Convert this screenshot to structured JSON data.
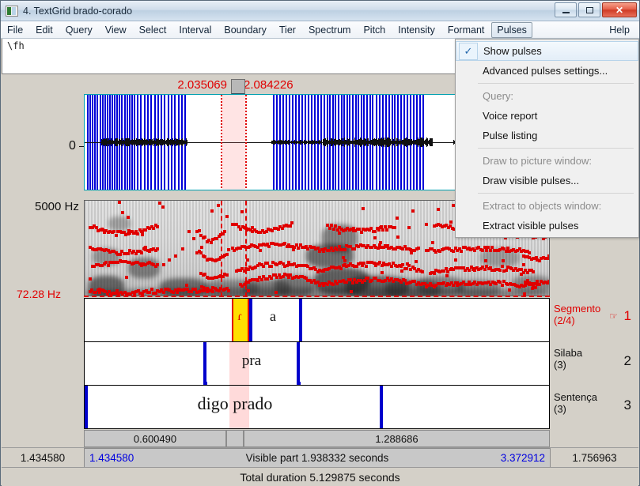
{
  "window": {
    "title": "4. TextGrid brado-corado",
    "icon": "textgrid-icon",
    "minimize_label": "–",
    "restore_label": "□",
    "close_label": "✕"
  },
  "menubar": {
    "items": [
      {
        "label": "File",
        "name": "menu-file"
      },
      {
        "label": "Edit",
        "name": "menu-edit"
      },
      {
        "label": "Query",
        "name": "menu-query"
      },
      {
        "label": "View",
        "name": "menu-view"
      },
      {
        "label": "Select",
        "name": "menu-select"
      },
      {
        "label": "Interval",
        "name": "menu-interval"
      },
      {
        "label": "Boundary",
        "name": "menu-boundary"
      },
      {
        "label": "Tier",
        "name": "menu-tier"
      },
      {
        "label": "Spectrum",
        "name": "menu-spectrum"
      },
      {
        "label": "Pitch",
        "name": "menu-pitch"
      },
      {
        "label": "Intensity",
        "name": "menu-intensity"
      },
      {
        "label": "Formant",
        "name": "menu-formant"
      },
      {
        "label": "Pulses",
        "name": "menu-pulses"
      }
    ],
    "help_label": "Help"
  },
  "pulses_menu": {
    "open": true,
    "checkmark": "✓",
    "items": [
      {
        "label": "Show pulses",
        "type": "check",
        "checked": true
      },
      {
        "label": "Advanced pulses settings...",
        "type": "item"
      },
      {
        "label": "Query:",
        "type": "header"
      },
      {
        "label": "Voice report",
        "type": "item"
      },
      {
        "label": "Pulse listing",
        "type": "item"
      },
      {
        "label": "Draw to picture window:",
        "type": "header"
      },
      {
        "label": "Draw visible pulses...",
        "type": "item"
      },
      {
        "label": "Extract to objects window:",
        "type": "header"
      },
      {
        "label": "Extract visible pulses",
        "type": "item"
      }
    ]
  },
  "textfield": {
    "value": "\\fh"
  },
  "cursor": {
    "start_time": "2.035069",
    "end_time": "2.084226"
  },
  "waveform": {
    "zero_label": "0"
  },
  "spectrogram": {
    "max_freq_label": "5000 Hz",
    "min_freq_label": "72.28 Hz"
  },
  "tiers": [
    {
      "number": "1",
      "name": "Segmento",
      "count": "(2/4)",
      "selected": true,
      "pointer_icon": "pointing-hand-icon",
      "intervals": [
        {
          "label": "ɾ",
          "center_pct": 34.2,
          "selected": true
        },
        {
          "label": "a",
          "center_pct": 47.0,
          "selected": false
        }
      ],
      "boundaries_pct": [
        34.7,
        46.0
      ]
    },
    {
      "number": "2",
      "name": "Silaba",
      "count": "(3)",
      "selected": false,
      "intervals": [
        {
          "label": "pra",
          "center_pct": 36.0,
          "selected": false
        }
      ],
      "boundaries_pct": [
        51.0,
        104.0
      ]
    },
    {
      "number": "3",
      "name": "Sentença",
      "count": "(3)",
      "selected": false,
      "intervals": [
        {
          "label": "digo prado",
          "center_pct": 32.5,
          "selected": false
        }
      ],
      "boundaries_pct": [
        0.4,
        63.9
      ]
    }
  ],
  "duration_bar": {
    "left_duration": "0.600490",
    "right_duration": "1.288686"
  },
  "visible_bar": {
    "far_left": "1.434580",
    "start": "1.434580",
    "center": "Visible part 1.938332 seconds",
    "end": "3.372912",
    "far_right": "1.756963"
  },
  "total_bar": {
    "text": "Total duration 5.129875 seconds"
  },
  "colors": {
    "pulse_blue": "#0000d8",
    "cursor_red": "#e00000",
    "selection_yellow": "#ffe000",
    "selection_pink": "#ffb4b4",
    "boundary_blue": "#0000cc"
  }
}
